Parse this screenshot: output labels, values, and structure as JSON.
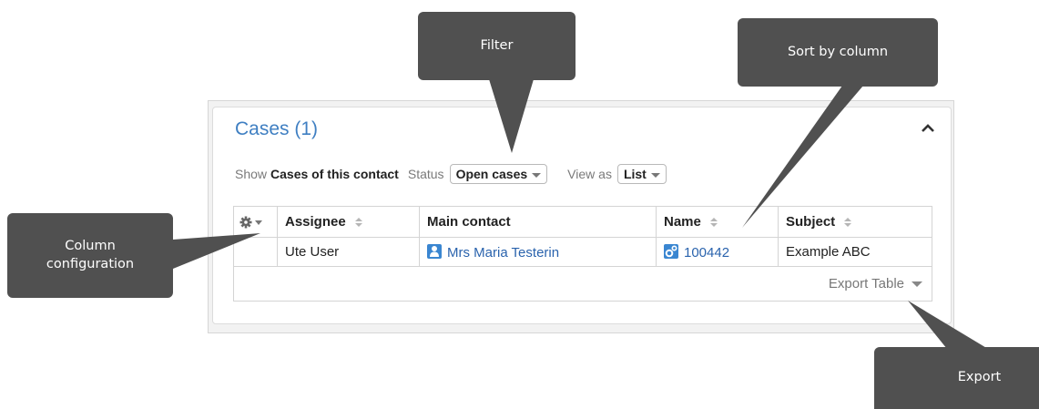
{
  "panel": {
    "title": "Cases (1)",
    "show_label": "Show",
    "show_value": "Cases of this contact",
    "status_label": "Status",
    "status_value": "Open cases",
    "view_label": "View as",
    "view_value": "List"
  },
  "table": {
    "columns": [
      "Assignee",
      "Main contact",
      "Name",
      "Subject"
    ],
    "rows": [
      {
        "assignee": "Ute User",
        "main_contact": "Mrs Maria Testerin",
        "name": "100442",
        "subject": "Example ABC"
      }
    ],
    "export_label": "Export Table"
  },
  "callouts": {
    "filter": "Filter",
    "sort": "Sort by column",
    "column_config_line1": "Column",
    "column_config_line2": "configuration",
    "export": "Export"
  },
  "icons": [
    "chevron-up-icon",
    "gear-icon",
    "sort-icon",
    "contact-person-icon",
    "case-icon",
    "caret-down-icon"
  ],
  "colors": {
    "accent": "#3f7fc2",
    "link": "#2a63ad",
    "callout": "#505050"
  }
}
